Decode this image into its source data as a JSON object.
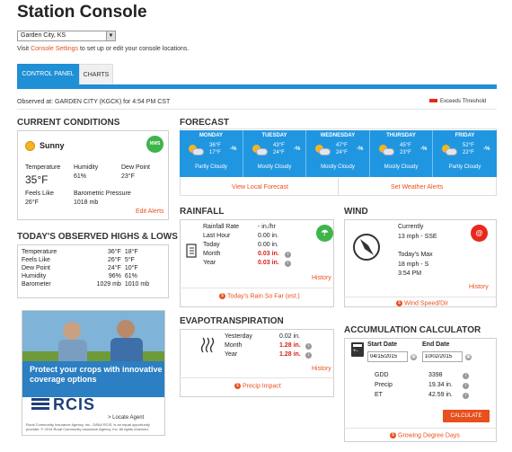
{
  "page": {
    "title": "Station Console"
  },
  "location_select": {
    "value": "Garden City, KS"
  },
  "visit": {
    "prefix": "Visit",
    "link": "Console Settings",
    "suffix": "to set up or edit your console locations."
  },
  "tabs": [
    {
      "label": "CONTROL PANEL"
    },
    {
      "label": "CHARTS"
    }
  ],
  "observed": "Observed at: GARDEN CITY (KGCK) for 4:54 PM CST",
  "legend": {
    "label": "Exceeds Threshold",
    "color": "#e8281e"
  },
  "current": {
    "heading": "CURRENT CONDITIONS",
    "condition": "Sunny",
    "badge": "NWS",
    "temperature_label": "Temperature",
    "temperature": "35°F",
    "humidity_label": "Humidity",
    "humidity": "61%",
    "dewpoint_label": "Dew Point",
    "dewpoint": "23°F",
    "feels_label": "Feels Like",
    "feels": "26°F",
    "pressure_label": "Barometric Pressure",
    "pressure": "1018 mb",
    "edit_alerts": "Edit Alerts"
  },
  "highs_lows": {
    "heading": "TODAY'S OBSERVED HIGHS & LOWS",
    "rows": [
      {
        "label": "Temperature",
        "high": "36°F",
        "low": "18°F"
      },
      {
        "label": "Feels Like",
        "high": "26°F",
        "low": "5°F"
      },
      {
        "label": "Dew Point",
        "high": "24°F",
        "low": "10°F"
      },
      {
        "label": "Humidity",
        "high": "96%",
        "low": "61%"
      },
      {
        "label": "Barometer",
        "high": "1029 mb",
        "low": "1010 mb"
      }
    ]
  },
  "forecast": {
    "heading": "FORECAST",
    "days": [
      {
        "day": "MONDAY",
        "hi": "36°F",
        "lo": "17°F",
        "pct": "-%",
        "desc": "Partly Cloudy"
      },
      {
        "day": "TUESDAY",
        "hi": "43°F",
        "lo": "24°F",
        "pct": "-%",
        "desc": "Mostly Cloudy"
      },
      {
        "day": "WEDNESDAY",
        "hi": "47°F",
        "lo": "24°F",
        "pct": "-%",
        "desc": "Mostly Cloudy"
      },
      {
        "day": "THURSDAY",
        "hi": "45°F",
        "lo": "23°F",
        "pct": "-%",
        "desc": "Mostly Cloudy"
      },
      {
        "day": "FRIDAY",
        "hi": "52°F",
        "lo": "22°F",
        "pct": "-%",
        "desc": "Partly Cloudy"
      }
    ],
    "link_left": "View Local Forecast",
    "link_right": "Set Weather Alerts"
  },
  "rainfall": {
    "heading": "RAINFALL",
    "rows": [
      {
        "label": "Rainfall Rate",
        "value": "- in./hr",
        "warn": false
      },
      {
        "label": "Last Hour",
        "value": "0.00 in.",
        "warn": false
      },
      {
        "label": "Today",
        "value": "0.00 in.",
        "warn": false
      },
      {
        "label": "Month",
        "value": "0.03 in.",
        "warn": true
      },
      {
        "label": "Year",
        "value": "0.03 in.",
        "warn": true
      }
    ],
    "history": "History",
    "footer": "Today's Rain So Far (est.)"
  },
  "wind": {
    "heading": "WIND",
    "currently_label": "Currently",
    "current": "13 mph - SSE",
    "max_label": "Today's Max",
    "max": "18 mph - S",
    "max_time": "3:54 PM",
    "history": "History",
    "footer": "Wind Speed/Dir"
  },
  "evapo": {
    "heading": "EVAPOTRANSPIRATION",
    "rows": [
      {
        "label": "Yesterday",
        "value": "0.02 in.",
        "warn": false
      },
      {
        "label": "Month",
        "value": "1.28 in.",
        "warn": true
      },
      {
        "label": "Year",
        "value": "1.28 in.",
        "warn": true
      }
    ],
    "history": "History",
    "footer": "Precip Impact"
  },
  "accum": {
    "heading": "ACCUMULATION CALCULATOR",
    "start_label": "Start Date",
    "start_value": "04/15/2015",
    "end_label": "End Date",
    "end_value": "10/02/2015",
    "rows": [
      {
        "label": "GDD",
        "value": "3398"
      },
      {
        "label": "Precip",
        "value": "19.34 in."
      },
      {
        "label": "ET",
        "value": "42.59 in."
      }
    ],
    "button": "CALCULATE",
    "footer": "Growing Degree Days"
  },
  "ad": {
    "headline": "Protect your crops with innovative coverage options",
    "brand": "RCIS",
    "locate": "> Locate Agent",
    "fine": "Rural Community Insurance Agency, Inc., D/B/A RCIS, is an equal opportunity provider. © 2014 Rural Community Insurance Agency, Inc. All rights reserved."
  }
}
